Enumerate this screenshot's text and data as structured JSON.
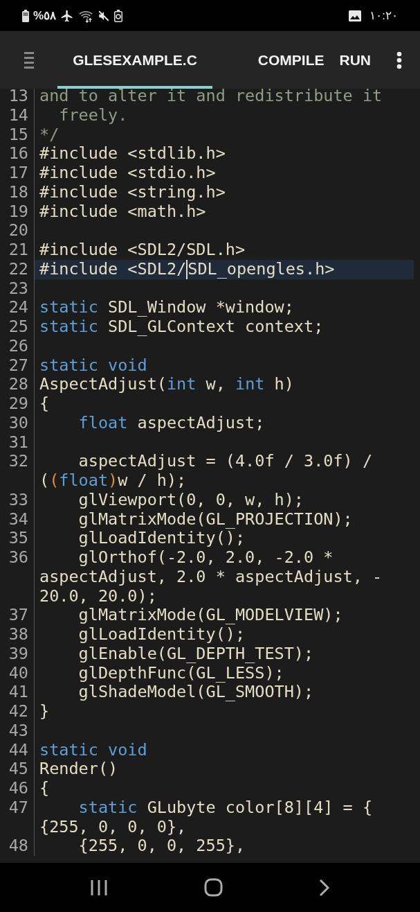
{
  "status_bar": {
    "battery": "%٥٨",
    "time": "١٠:٢٠"
  },
  "toolbar": {
    "tabs": [
      {
        "label": "GLESEXAMPLE.C",
        "selected": true
      }
    ],
    "actions": [
      "COMPILE",
      "RUN"
    ]
  },
  "editor": {
    "lines": [
      {
        "number": "13",
        "current": false,
        "rows": [
          {
            "tokens": [
              {
                "text": "and to alter it and redistribute it",
                "kind": "comment"
              }
            ]
          }
        ]
      },
      {
        "number": "14",
        "current": false,
        "rows": [
          {
            "tokens": [
              {
                "text": "  freely.",
                "kind": "comment"
              }
            ]
          }
        ]
      },
      {
        "number": "15",
        "current": false,
        "rows": [
          {
            "tokens": [
              {
                "text": "*/",
                "kind": "comment"
              }
            ]
          }
        ]
      },
      {
        "number": "16",
        "current": false,
        "rows": [
          {
            "tokens": [
              {
                "text": "#include <stdlib.h>",
                "kind": "plain"
              }
            ]
          }
        ]
      },
      {
        "number": "17",
        "current": false,
        "rows": [
          {
            "tokens": [
              {
                "text": "#include <stdio.h>",
                "kind": "plain"
              }
            ]
          }
        ]
      },
      {
        "number": "18",
        "current": false,
        "rows": [
          {
            "tokens": [
              {
                "text": "#include <string.h>",
                "kind": "plain"
              }
            ]
          }
        ]
      },
      {
        "number": "19",
        "current": false,
        "rows": [
          {
            "tokens": [
              {
                "text": "#include <math.h>",
                "kind": "plain"
              }
            ]
          }
        ]
      },
      {
        "number": "20",
        "current": false
      },
      {
        "number": "21",
        "current": false,
        "rows": [
          {
            "tokens": [
              {
                "text": "#include <SDL2/SDL.h>",
                "kind": "plain"
              }
            ]
          }
        ]
      },
      {
        "number": "22",
        "current": true,
        "rows": [
          {
            "tokens": [
              {
                "text": "#include <SDL2/",
                "kind": "plain"
              },
              {
                "text": "SDL_opengles.h>",
                "kind": "plain",
                "cursor_before": true
              }
            ]
          }
        ]
      },
      {
        "number": "23",
        "current": false
      },
      {
        "number": "24",
        "current": false,
        "rows": [
          {
            "tokens": [
              {
                "text": "static",
                "kind": "keyword"
              },
              {
                "text": " SDL_Window *window;",
                "kind": "plain"
              }
            ]
          }
        ]
      },
      {
        "number": "25",
        "current": false,
        "rows": [
          {
            "tokens": [
              {
                "text": "static",
                "kind": "keyword"
              },
              {
                "text": " SDL_GLContext context;",
                "kind": "plain"
              }
            ]
          }
        ]
      },
      {
        "number": "26",
        "current": false
      },
      {
        "number": "27",
        "current": false,
        "rows": [
          {
            "tokens": [
              {
                "text": "static void",
                "kind": "keyword"
              }
            ]
          }
        ]
      },
      {
        "number": "28",
        "current": false,
        "rows": [
          {
            "tokens": [
              {
                "text": "AspectAdjust(",
                "kind": "plain"
              },
              {
                "text": "int",
                "kind": "keyword"
              },
              {
                "text": " w, ",
                "kind": "plain"
              },
              {
                "text": "int",
                "kind": "keyword"
              },
              {
                "text": " h)",
                "kind": "plain"
              }
            ]
          }
        ]
      },
      {
        "number": "29",
        "current": false,
        "rows": [
          {
            "tokens": [
              {
                "text": "{",
                "kind": "plain"
              }
            ]
          }
        ]
      },
      {
        "number": "30",
        "current": false,
        "rows": [
          {
            "tokens": [
              {
                "text": "    float",
                "kind": "keyword"
              },
              {
                "text": " aspectAdjust;",
                "kind": "plain"
              }
            ]
          }
        ]
      },
      {
        "number": "31",
        "current": false
      },
      {
        "number": "32",
        "current": false,
        "rows": [
          {
            "tokens": [
              {
                "text": "    aspectAdjust = (4.0f / 3.0f) /",
                "kind": "plain"
              }
            ]
          },
          {
            "tokens": [
              {
                "text": "(",
                "kind": "plain"
              },
              {
                "text": "(",
                "kind": "match"
              },
              {
                "text": "float",
                "kind": "keyword"
              },
              {
                "text": ")",
                "kind": "match"
              },
              {
                "text": "w / h);",
                "kind": "plain"
              }
            ]
          }
        ]
      },
      {
        "number": "33",
        "current": false,
        "rows": [
          {
            "tokens": [
              {
                "text": "    glViewport(0, 0, w, h);",
                "kind": "plain"
              }
            ]
          }
        ]
      },
      {
        "number": "34",
        "current": false,
        "rows": [
          {
            "tokens": [
              {
                "text": "    glMatrixMode(GL_PROJECTION);",
                "kind": "plain"
              }
            ]
          }
        ]
      },
      {
        "number": "35",
        "current": false,
        "rows": [
          {
            "tokens": [
              {
                "text": "    glLoadIdentity();",
                "kind": "plain"
              }
            ]
          }
        ]
      },
      {
        "number": "36",
        "current": false,
        "rows": [
          {
            "tokens": [
              {
                "text": "    glOrthof(-2.0, 2.0, -2.0 *",
                "kind": "plain"
              }
            ]
          },
          {
            "tokens": [
              {
                "text": "aspectAdjust, 2.0 * aspectAdjust, -",
                "kind": "plain"
              }
            ]
          },
          {
            "tokens": [
              {
                "text": "20.0, 20.0);",
                "kind": "plain"
              }
            ]
          }
        ]
      },
      {
        "number": "37",
        "current": false,
        "rows": [
          {
            "tokens": [
              {
                "text": "    glMatrixMode(GL_MODELVIEW);",
                "kind": "plain"
              }
            ]
          }
        ]
      },
      {
        "number": "38",
        "current": false,
        "rows": [
          {
            "tokens": [
              {
                "text": "    glLoadIdentity();",
                "kind": "plain"
              }
            ]
          }
        ]
      },
      {
        "number": "39",
        "current": false,
        "rows": [
          {
            "tokens": [
              {
                "text": "    glEnable(GL_DEPTH_TEST);",
                "kind": "plain"
              }
            ]
          }
        ]
      },
      {
        "number": "40",
        "current": false,
        "rows": [
          {
            "tokens": [
              {
                "text": "    glDepthFunc(GL_LESS);",
                "kind": "plain"
              }
            ]
          }
        ]
      },
      {
        "number": "41",
        "current": false,
        "rows": [
          {
            "tokens": [
              {
                "text": "    glShadeModel(GL_SMOOTH);",
                "kind": "plain"
              }
            ]
          }
        ]
      },
      {
        "number": "42",
        "current": false,
        "rows": [
          {
            "tokens": [
              {
                "text": "}",
                "kind": "plain"
              }
            ]
          }
        ]
      },
      {
        "number": "43",
        "current": false
      },
      {
        "number": "44",
        "current": false,
        "rows": [
          {
            "tokens": [
              {
                "text": "static void",
                "kind": "keyword"
              }
            ]
          }
        ]
      },
      {
        "number": "45",
        "current": false,
        "rows": [
          {
            "tokens": [
              {
                "text": "Render()",
                "kind": "plain"
              }
            ]
          }
        ]
      },
      {
        "number": "46",
        "current": false,
        "rows": [
          {
            "tokens": [
              {
                "text": "{",
                "kind": "plain"
              }
            ]
          }
        ]
      },
      {
        "number": "47",
        "current": false,
        "rows": [
          {
            "tokens": [
              {
                "text": "    static",
                "kind": "keyword"
              },
              {
                "text": " GLubyte color[8][4] = {",
                "kind": "plain"
              }
            ]
          },
          {
            "tokens": [
              {
                "text": "{255, 0, 0, 0},",
                "kind": "plain"
              }
            ]
          }
        ]
      },
      {
        "number": "48",
        "current": false,
        "rows": [
          {
            "tokens": [
              {
                "text": "    {255, 0, 0, 255},",
                "kind": "plain"
              }
            ]
          }
        ]
      }
    ]
  }
}
